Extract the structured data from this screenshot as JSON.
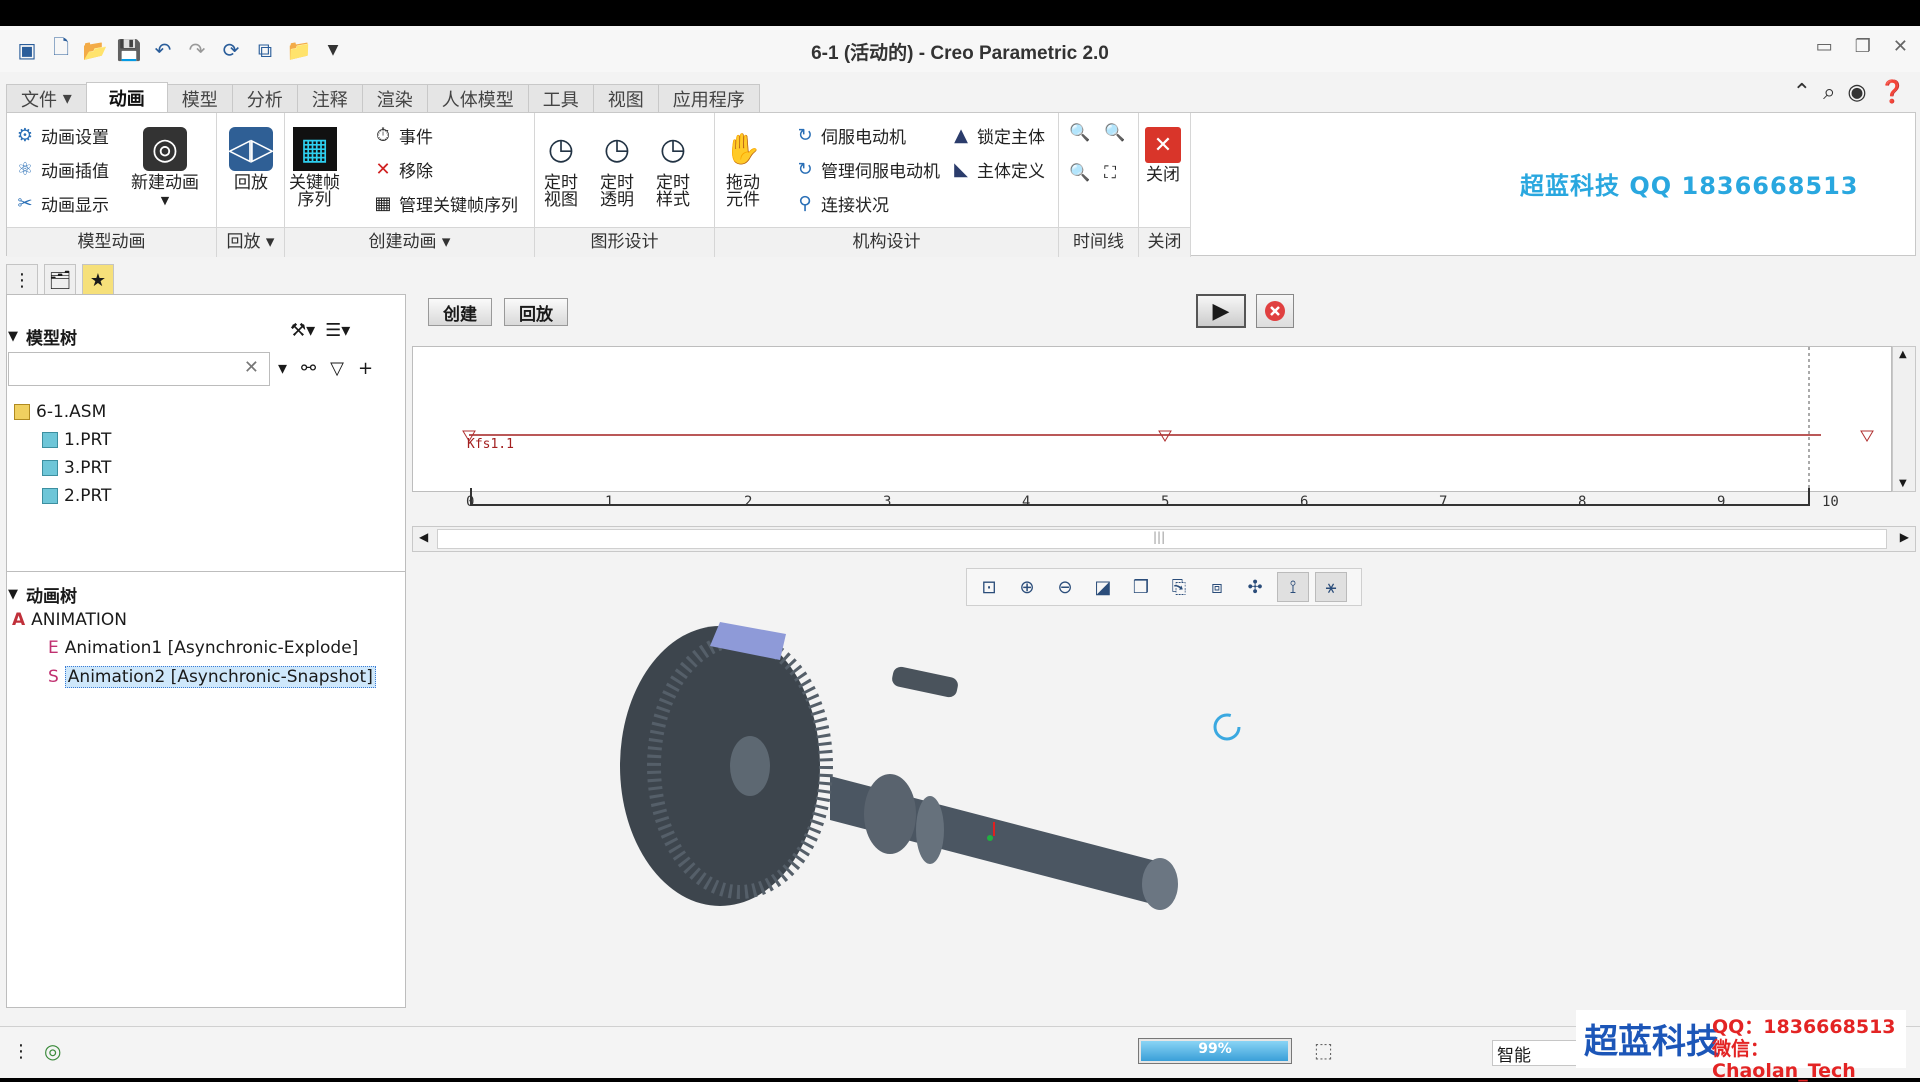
{
  "window": {
    "title": "6-1 (活动的) - Creo Parametric 2.0"
  },
  "tabs": [
    "文件",
    "动画",
    "模型",
    "分析",
    "注释",
    "渲染",
    "人体模型",
    "工具",
    "视图",
    "应用程序"
  ],
  "active_tab": "动画",
  "ribbon": {
    "groups": {
      "model_animation": "模型动画",
      "playback": "回放",
      "create_animation": "创建动画",
      "graphic_design": "图形设计",
      "mechanism_design": "机构设计",
      "timeline": "时间线",
      "close": "关闭"
    },
    "model_animation": {
      "settings": "动画设置",
      "interpolation": "动画插值",
      "display": "动画显示"
    },
    "new_animation": "新建动画",
    "playback": "回放",
    "keyframe_seq": "关键帧\n序列",
    "create": {
      "event": "事件",
      "remove": "移除",
      "manage_keyframe": "管理关键帧序列"
    },
    "graphic": {
      "timed_view": "定时\n视图",
      "timed_transparency": "定时\n透明",
      "timed_style": "定时\n样式"
    },
    "drag": "拖动\n元件",
    "mechanism": {
      "servo": "伺服电动机",
      "manage_servo": "管理伺服电动机",
      "connection": "连接状况",
      "lock_body": "锁定主体",
      "body_def": "主体定义"
    },
    "close": "关闭"
  },
  "brand_text": "超蓝科技 QQ 1836668513",
  "panel_tabs": {
    "create": "创建",
    "playback": "回放"
  },
  "model_tree": {
    "title": "模型树",
    "items": [
      "6-1.ASM",
      "1.PRT",
      "3.PRT",
      "2.PRT"
    ]
  },
  "animation_tree": {
    "title": "动画树",
    "root": "ANIMATION",
    "items": [
      "Animation1 [Asynchronic-Explode]",
      "Animation2 [Asynchronic-Snapshot]"
    ]
  },
  "timeline": {
    "keyframe_label": "Kfs1.1",
    "ticks": [
      "0",
      "1",
      "2",
      "3",
      "4",
      "5",
      "6",
      "7",
      "8",
      "9",
      "10"
    ],
    "end_value": 10
  },
  "status": {
    "progress_text": "99%",
    "progress": 0.99,
    "filter": "智能"
  },
  "watermark": {
    "brand": "超蓝科技",
    "qq": "QQ：1836668513",
    "wechat": "微信：Chaolan_Tech"
  }
}
